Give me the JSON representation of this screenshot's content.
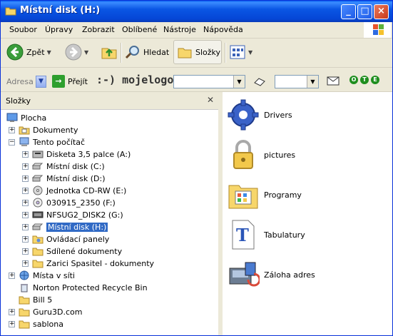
{
  "window": {
    "title": "Místní disk (H:)"
  },
  "menu": [
    "Soubor",
    "Úpravy",
    "Zobrazit",
    "Oblíbené",
    "Nástroje",
    "Nápověda"
  ],
  "toolbar": {
    "back_label": "Zpět",
    "search_label": "Hledat",
    "folders_label": "Složky"
  },
  "address": {
    "label": "Adresa",
    "go_label": "Přejít",
    "brand": ":-) mojelogo",
    "dots": [
      "O",
      "T",
      "E"
    ]
  },
  "left_panel": {
    "title": "Složky",
    "tree": [
      {
        "label": "Plocha"
      },
      {
        "label": "Dokumenty"
      },
      {
        "label": "Tento počítač"
      },
      {
        "label": "Disketa 3,5 palce (A:)"
      },
      {
        "label": "Místní disk (C:)"
      },
      {
        "label": "Místní disk (D:)"
      },
      {
        "label": "Jednotka CD-RW (E:)"
      },
      {
        "label": "030915_2350 (F:)"
      },
      {
        "label": "NFSUG2_DISK2 (G:)"
      },
      {
        "label": "Místní disk (H:)"
      },
      {
        "label": "Ovládací panely"
      },
      {
        "label": "Sdílené dokumenty"
      },
      {
        "label": "Zarici Spasitel - dokumenty"
      },
      {
        "label": "Místa v síti"
      },
      {
        "label": "Norton Protected Recycle Bin"
      },
      {
        "label": "Bill 5"
      },
      {
        "label": "Guru3D.com"
      },
      {
        "label": "sablona"
      }
    ]
  },
  "right_panel": {
    "items": [
      {
        "label": "Drivers"
      },
      {
        "label": "pictures"
      },
      {
        "label": "Programy"
      },
      {
        "label": "Tabulatury"
      },
      {
        "label": "Záloha adres"
      }
    ]
  },
  "colors": {
    "title_blue": "#0A56E4",
    "selection": "#316AC5",
    "folder": "#F7D66B"
  }
}
